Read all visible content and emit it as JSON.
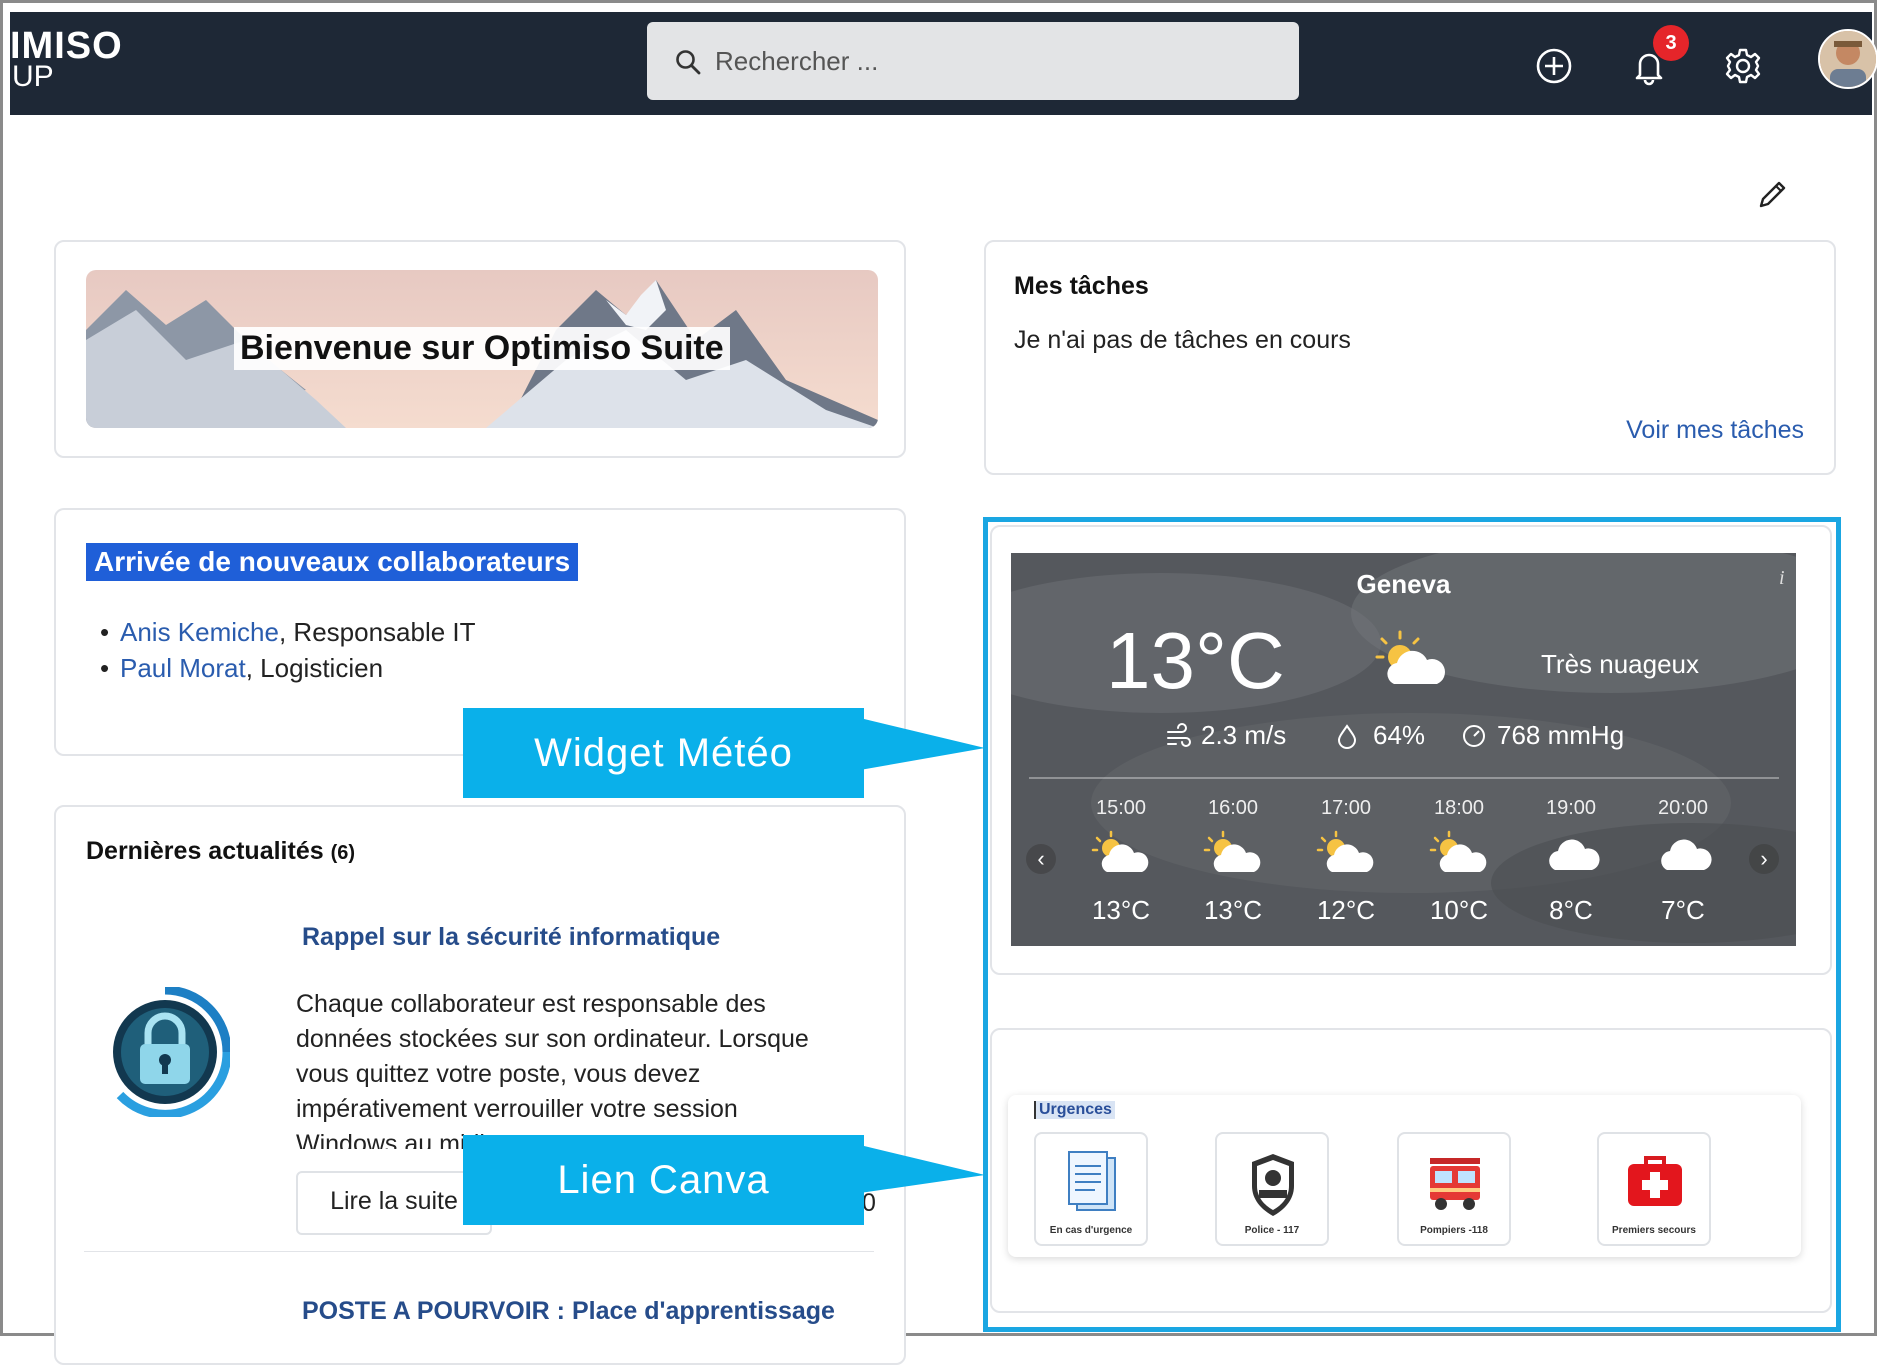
{
  "header": {
    "logo_line1": "IMISO",
    "logo_line2": "UP",
    "search_placeholder": "Rechercher ...",
    "notifications_count": "3"
  },
  "welcome": {
    "banner_title": "Bienvenue sur Optimiso Suite"
  },
  "arrivals": {
    "title": "Arrivée de nouveaux collaborateurs",
    "items": [
      {
        "name": "Anis Kemiche",
        "role": ", Responsable IT"
      },
      {
        "name": "Paul Morat",
        "role": ", Logisticien"
      }
    ]
  },
  "tasks": {
    "title": "Mes tâches",
    "empty_text": "Je n'ai pas de tâches en cours",
    "link": "Voir mes tâches"
  },
  "news": {
    "title": "Dernières actualités",
    "count": "(6)",
    "item1": {
      "title": "Rappel sur la sécurité informatique",
      "text": "Chaque collaborateur est responsable des données stockées sur son ordinateur. Lorsque vous quittez votre poste, vous devez impérativement verrouiller votre session Windows au midi.",
      "read_more": "Lire la suite",
      "trailing": "0"
    },
    "item2": {
      "title": "POSTE A POURVOIR : Place d'apprentissage"
    }
  },
  "weather": {
    "city": "Geneva",
    "info": "i",
    "temp": "13°C",
    "description": "Très nuageux",
    "wind": "2.3 m/s",
    "humidity": "64%",
    "pressure": "768 mmHg",
    "prev": "‹",
    "next": "›",
    "hourly": [
      {
        "hour": "15:00",
        "temp": "13°C",
        "icon": "partly-cloudy-icon"
      },
      {
        "hour": "16:00",
        "temp": "13°C",
        "icon": "partly-cloudy-icon"
      },
      {
        "hour": "17:00",
        "temp": "12°C",
        "icon": "partly-cloudy-icon"
      },
      {
        "hour": "18:00",
        "temp": "10°C",
        "icon": "partly-cloudy-icon"
      },
      {
        "hour": "19:00",
        "temp": "8°C",
        "icon": "cloud-icon"
      },
      {
        "hour": "20:00",
        "temp": "7°C",
        "icon": "cloud-icon"
      }
    ]
  },
  "emergency": {
    "label": "Urgences",
    "tiles": [
      {
        "caption": "En cas d'urgence",
        "icon": "document-icon"
      },
      {
        "caption": "Police - 117",
        "icon": "police-badge-icon"
      },
      {
        "caption": "Pompiers -118",
        "icon": "fire-truck-icon"
      },
      {
        "caption": "Premiers secours",
        "icon": "first-aid-icon"
      }
    ]
  },
  "callouts": {
    "weather": "Widget Météo",
    "canva": "Lien Canva"
  },
  "colors": {
    "topbar": "#1e2836",
    "accent_blue": "#1aa6e2",
    "callout": "#0ab0ea",
    "link": "#2a5cae",
    "badge": "#e5252a"
  }
}
